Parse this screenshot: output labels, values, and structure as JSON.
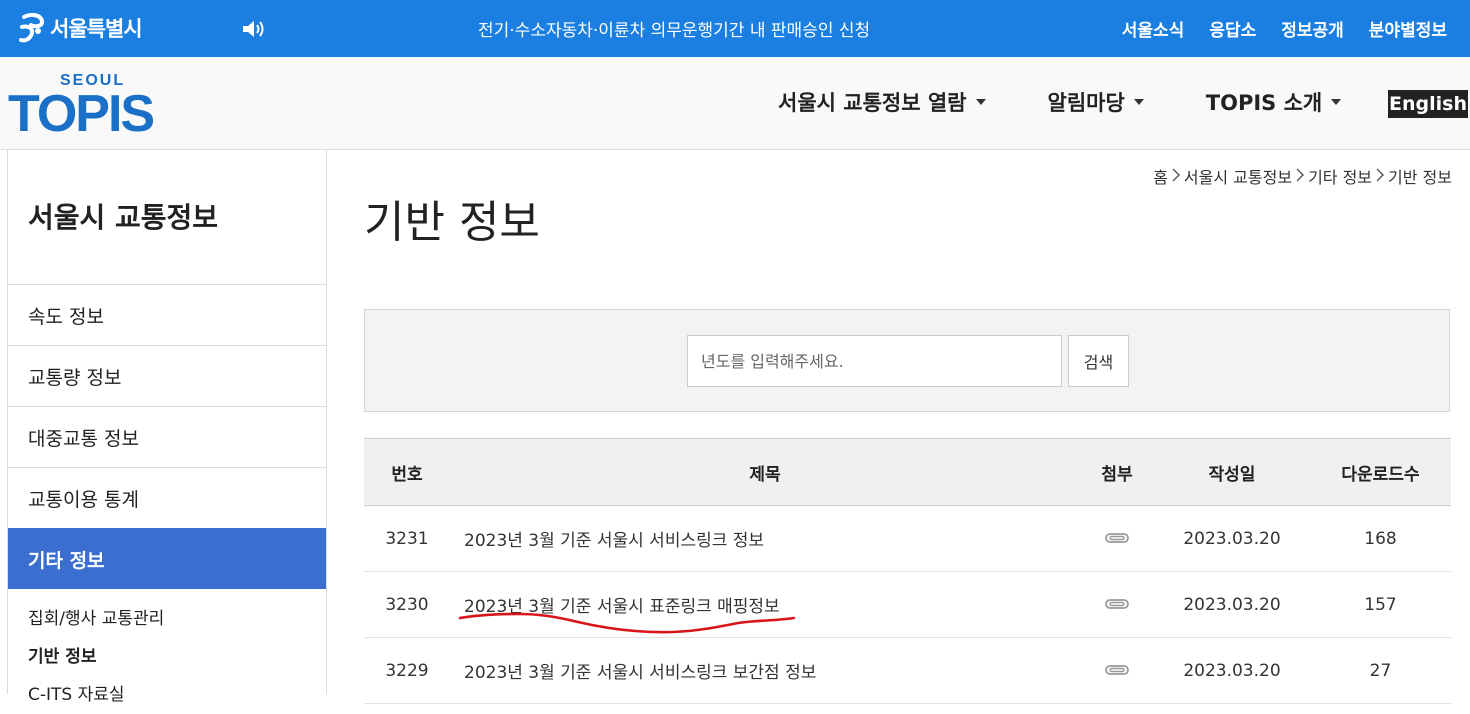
{
  "topbar": {
    "brand": "서울특별시",
    "notice": "전기·수소자동차·이륜차 의무운행기간 내 판매승인 신청",
    "links": [
      "서울소식",
      "응답소",
      "정보공개",
      "분야별정보"
    ]
  },
  "header": {
    "logo_small": "SEOUL",
    "logo_main": "TOPIS",
    "nav": [
      "서울시 교통정보 열람",
      "알림마당",
      "TOPIS 소개"
    ],
    "english": "English"
  },
  "sidebar": {
    "title": "서울시 교통정보",
    "items": [
      {
        "label": "속도 정보"
      },
      {
        "label": "교통량 정보"
      },
      {
        "label": "대중교통 정보"
      },
      {
        "label": "교통이용 통계"
      },
      {
        "label": "기타 정보"
      }
    ],
    "active_index": 4,
    "sub_items": [
      "집회/행사 교통관리",
      "기반 정보",
      "C-ITS 자료실"
    ],
    "current_sub_index": 1
  },
  "breadcrumb": [
    "홈",
    "서울시 교통정보",
    "기타 정보",
    "기반 정보"
  ],
  "page_title": "기반 정보",
  "search": {
    "placeholder": "년도를 입력해주세요.",
    "button": "검색"
  },
  "table": {
    "headers": [
      "번호",
      "제목",
      "첨부",
      "작성일",
      "다운로드수"
    ],
    "rows": [
      {
        "num": "3231",
        "title": "2023년 3월 기준 서울시 서비스링크 정보",
        "date": "2023.03.20",
        "downloads": "168"
      },
      {
        "num": "3230",
        "title": "2023년 3월 기준 서울시 표준링크 매핑정보",
        "date": "2023.03.20",
        "downloads": "157"
      },
      {
        "num": "3229",
        "title": "2023년 3월 기준 서울시 서비스링크 보간점 정보",
        "date": "2023.03.20",
        "downloads": "27"
      }
    ]
  },
  "colors": {
    "topbar": "#1a7fe0",
    "active_menu": "#3a6fd0",
    "annotation": "#d8141b"
  }
}
